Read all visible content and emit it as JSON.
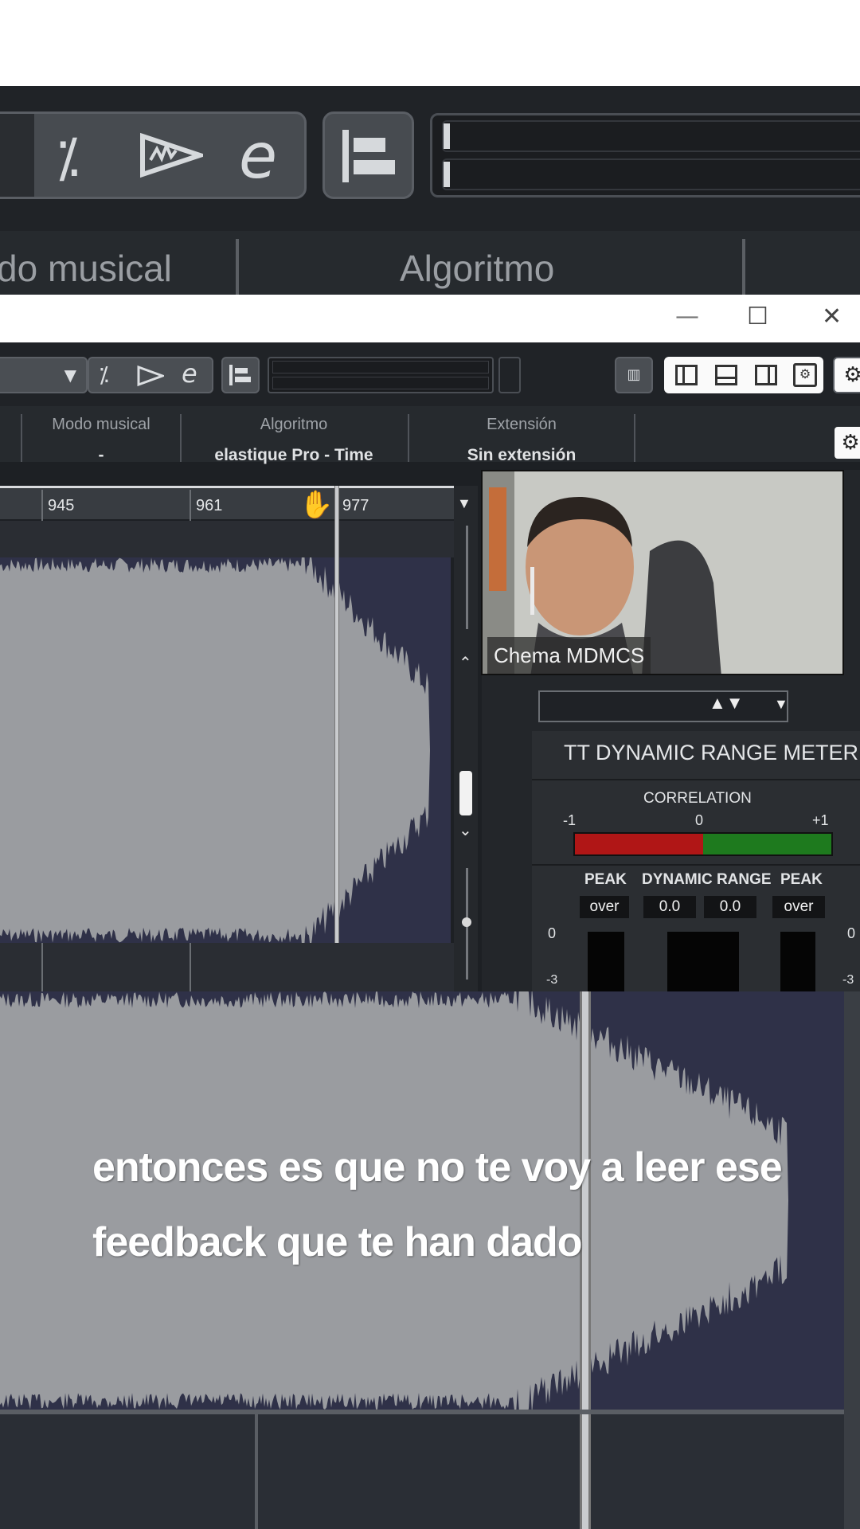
{
  "zoom_top": {
    "header_left": "do musical",
    "header_right": "Algoritmo"
  },
  "window": {
    "controls": {
      "minimize": "—",
      "maximize": "☐",
      "close": "✕"
    },
    "columns": [
      {
        "label": "Modo musical",
        "value": "-"
      },
      {
        "label": "Algoritmo",
        "value": "elastique Pro - Time"
      },
      {
        "label": "Extensión",
        "value": "Sin extensión"
      }
    ],
    "ruler_ticks": [
      "945",
      "961",
      "977"
    ]
  },
  "webcam": {
    "name": "Chema MDMCS"
  },
  "meter": {
    "title": "TT DYNAMIC RANGE METER",
    "correlation_label": "CORRELATION",
    "corr_min": "-1",
    "corr_mid": "0",
    "corr_max": "+1",
    "peak_left_label": "PEAK",
    "dr_label": "DYNAMIC RANGE",
    "peak_right_label": "PEAK",
    "peak_left_value": "over",
    "dr_left_value": "0.0",
    "dr_right_value": "0.0",
    "peak_right_value": "over",
    "scale_0": "0",
    "scale_minus3": "-3",
    "correlation_level": 0.5
  },
  "caption": {
    "line1": "entonces es que no te voy a leer ese",
    "line2": "feedback que te han dado"
  },
  "colors": {
    "waveform": "#9a9ca0",
    "wave_bg": "#2f3148",
    "corr_red": "#b01616",
    "corr_green": "#1e7a1e"
  }
}
